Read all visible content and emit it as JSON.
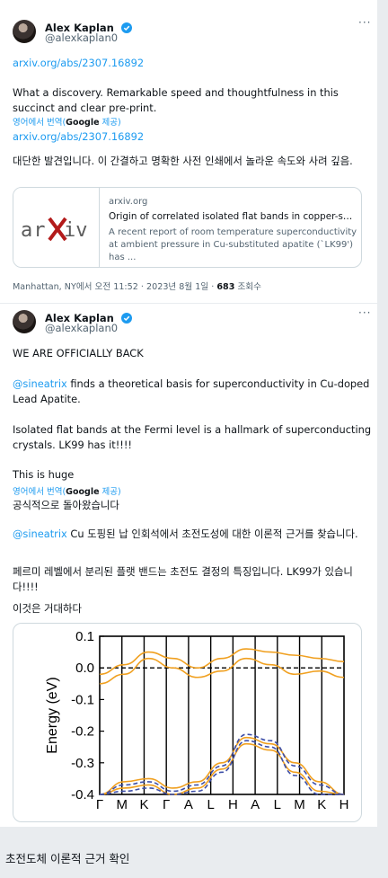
{
  "tweet1": {
    "author": "Alex Kaplan",
    "handle": "@alexkaplan0",
    "link_top": "arxiv.org/abs/2307.16892",
    "body_en": "What a discovery. Remarkable speed and thoughtfulness in this succinct and clear pre-print.",
    "link_inline": "arxiv.org/abs/2307.16892",
    "translate_prefix": "영어에서 번역(",
    "translate_brand": "Google",
    "translate_suffix": " 제공)",
    "body_ko": "대단한 발견입니다. 이 간결하고 명확한 사전 인쇄에서 놀라운 속도와 사려 깊음.",
    "card": {
      "logo": "arXiv",
      "domain": "arxiv.org",
      "title": "Origin of correlated isolated flat bands in copper-substitut...",
      "desc": "A recent report of room temperature superconductivity at ambient pressure in Cu-substituted apatite (`LK99') has ..."
    },
    "meta": "Manhattan, NY에서 오전 11:52 · 2023년 8월 1일 · ",
    "views": "683",
    "views_label": " 조회수",
    "icons": {
      "verified": "verified-badge-icon",
      "more": "more-options-icon"
    }
  },
  "tweet2": {
    "author": "Alex Kaplan",
    "handle": "@alexkaplan0",
    "line1": "WE ARE OFFICIALLY BACK",
    "mention": "@sineatrix",
    "para2_rest": " finds a theoretical basis for superconductivity in Cu-doped Lead Apatite.",
    "para3": "Isolated flat bands at the Fermi level is a hallmark of superconducting crystals. LK99 has it!!!!",
    "para4": "This is huge",
    "translate_prefix": "영어에서 번역(",
    "translate_brand": "Google",
    "translate_suffix": " 제공)",
    "ko1": "공식적으로 돌아왔습니다",
    "ko_mention": "@sineatrix",
    "ko2_rest": " Cu 도핑된 납 인회석에서 초전도성에 대한 이론적 근거를 찾습니다.",
    "ko3": "페르미 레벨에서 분리된 플랫 밴드는 초전도 결정의 특징입니다. LK99가 있습니다!!!!",
    "ko4": "이것은 거대하다"
  },
  "caption": "초전도체 이론적 근거 확인",
  "chart_data": {
    "type": "line",
    "ylabel": "Energy (eV)",
    "ylim": [
      -0.4,
      0.1
    ],
    "yticks": [
      "0.1",
      "0.0",
      "-0.1",
      "-0.2",
      "-0.3",
      "-0.4"
    ],
    "xticks": [
      "Γ",
      "M",
      "K",
      "Γ",
      "A",
      "L",
      "H",
      "A",
      "L",
      "M",
      "K",
      "H"
    ],
    "fermi_level": 0.0,
    "colors": {
      "solid": "#f0a020",
      "dashed": "#3e4fa8",
      "fermi": "#000000"
    },
    "series": [
      {
        "style": "solid",
        "x": [
          0,
          1,
          2,
          3,
          4,
          5,
          6,
          7,
          8,
          9,
          10
        ],
        "values": [
          -0.02,
          0.01,
          0.05,
          0.03,
          0.0,
          0.03,
          0.06,
          0.05,
          0.04,
          0.03,
          0.02
        ]
      },
      {
        "style": "solid",
        "x": [
          0,
          1,
          2,
          3,
          4,
          5,
          6,
          7,
          8,
          9,
          10
        ],
        "values": [
          -0.05,
          -0.02,
          0.03,
          0.0,
          -0.03,
          -0.01,
          0.03,
          0.01,
          -0.02,
          -0.01,
          -0.03
        ]
      },
      {
        "style": "solid",
        "x": [
          0,
          1,
          2,
          3,
          4,
          5,
          6,
          7,
          8,
          9,
          10
        ],
        "values": [
          -0.4,
          -0.36,
          -0.35,
          -0.38,
          -0.36,
          -0.3,
          -0.22,
          -0.24,
          -0.3,
          -0.36,
          -0.4
        ]
      },
      {
        "style": "solid",
        "x": [
          0,
          1,
          2,
          3,
          4,
          5,
          6,
          7,
          8,
          9,
          10
        ],
        "values": [
          -0.4,
          -0.38,
          -0.37,
          -0.4,
          -0.38,
          -0.32,
          -0.24,
          -0.26,
          -0.33,
          -0.39,
          -0.4
        ]
      },
      {
        "style": "dashed",
        "x": [
          0,
          1,
          2,
          3,
          4,
          5,
          6,
          7,
          8,
          9,
          10
        ],
        "values": [
          -0.41,
          -0.37,
          -0.36,
          -0.39,
          -0.37,
          -0.31,
          -0.21,
          -0.23,
          -0.31,
          -0.37,
          -0.41
        ]
      },
      {
        "style": "dashed",
        "x": [
          0,
          1,
          2,
          3,
          4,
          5,
          6,
          7,
          8,
          9,
          10
        ],
        "values": [
          -0.41,
          -0.39,
          -0.38,
          -0.41,
          -0.39,
          -0.33,
          -0.23,
          -0.25,
          -0.34,
          -0.4,
          -0.41
        ]
      }
    ]
  }
}
